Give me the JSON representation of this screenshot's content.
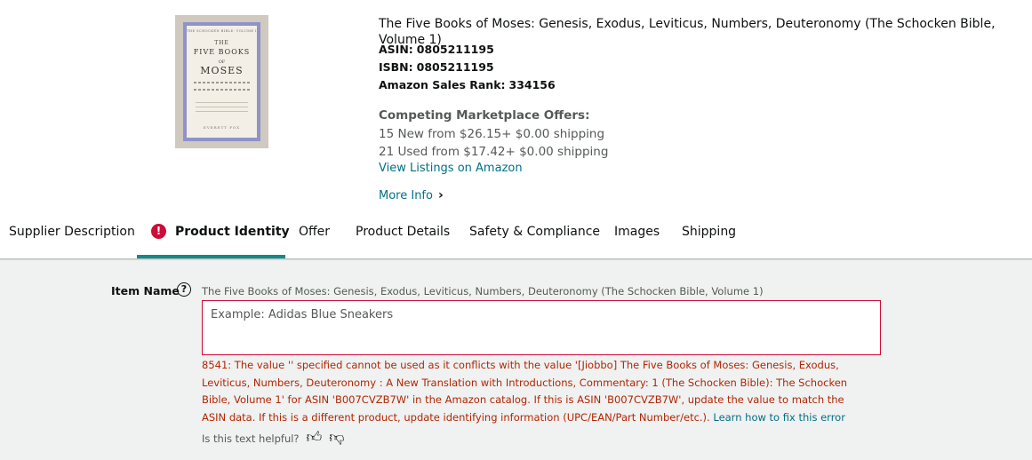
{
  "product": {
    "title": "The Five Books of Moses: Genesis, Exodus, Leviticus, Numbers, Deuteronomy (The Schocken Bible, Volume 1)",
    "asin_label": "ASIN:",
    "asin": "0805211195",
    "isbn_label": "ISBN:",
    "isbn": "0805211195",
    "rank_label": "Amazon Sales Rank:",
    "rank": "334156",
    "offers_heading": "Competing Marketplace Offers:",
    "offers": [
      "15 New  from $26.15+ $0.00 shipping",
      "21 Used  from $17.42+ $0.00 shipping"
    ],
    "view_listings": "View Listings on Amazon",
    "more_info": "More Info",
    "cover": {
      "series": "THE SCHOCKEN BIBLE: VOLUME I",
      "line1": "THE",
      "line2": "FIVE BOOKS",
      "line3": "OF",
      "line4": "MOSES",
      "author": "EVERETT FOX"
    }
  },
  "tabs": [
    {
      "label": "Supplier Description",
      "active": false,
      "error": false
    },
    {
      "label": "Product Identity",
      "active": true,
      "error": true
    },
    {
      "label": "Offer",
      "active": false,
      "error": false
    },
    {
      "label": "Product Details",
      "active": false,
      "error": false
    },
    {
      "label": "Safety & Compliance",
      "active": false,
      "error": false
    },
    {
      "label": "Images",
      "active": false,
      "error": false
    },
    {
      "label": "Shipping",
      "active": false,
      "error": false
    }
  ],
  "form": {
    "item_name_label": "Item Name",
    "help_glyph": "?",
    "current_value": "The Five Books of Moses: Genesis, Exodus, Leviticus, Numbers, Deuteronomy (The Schocken Bible, Volume 1)",
    "placeholder": "Example: Adidas Blue Sneakers",
    "input_value": "",
    "error_text": "8541: The value '' specified cannot be used as it conflicts with the value '[Jiobbo] The Five Books of Moses: Genesis, Exodus, Leviticus, Numbers, Deuteronomy : A New Translation with Introductions, Commentary: 1 (The Schocken Bible): The Schocken Bible, Volume 1' for ASIN 'B007CVZB7W' in the Amazon catalog. If this is ASIN 'B007CVZB7W', update the value to match the ASIN data. If this is a different product, update identifying information (UPC/EAN/Part Number/etc.).",
    "error_link": "Learn how to fix this error",
    "helpful_text": "Is this text helpful?"
  },
  "colors": {
    "error": "#b12704",
    "link": "#007185",
    "active_tab_underline": "#118a8a",
    "form_background": "#f0f1f1"
  },
  "icons": [
    "help-circle-icon",
    "error-alert-icon",
    "chevron-right-icon",
    "thumbs-up-icon",
    "thumbs-down-icon"
  ]
}
